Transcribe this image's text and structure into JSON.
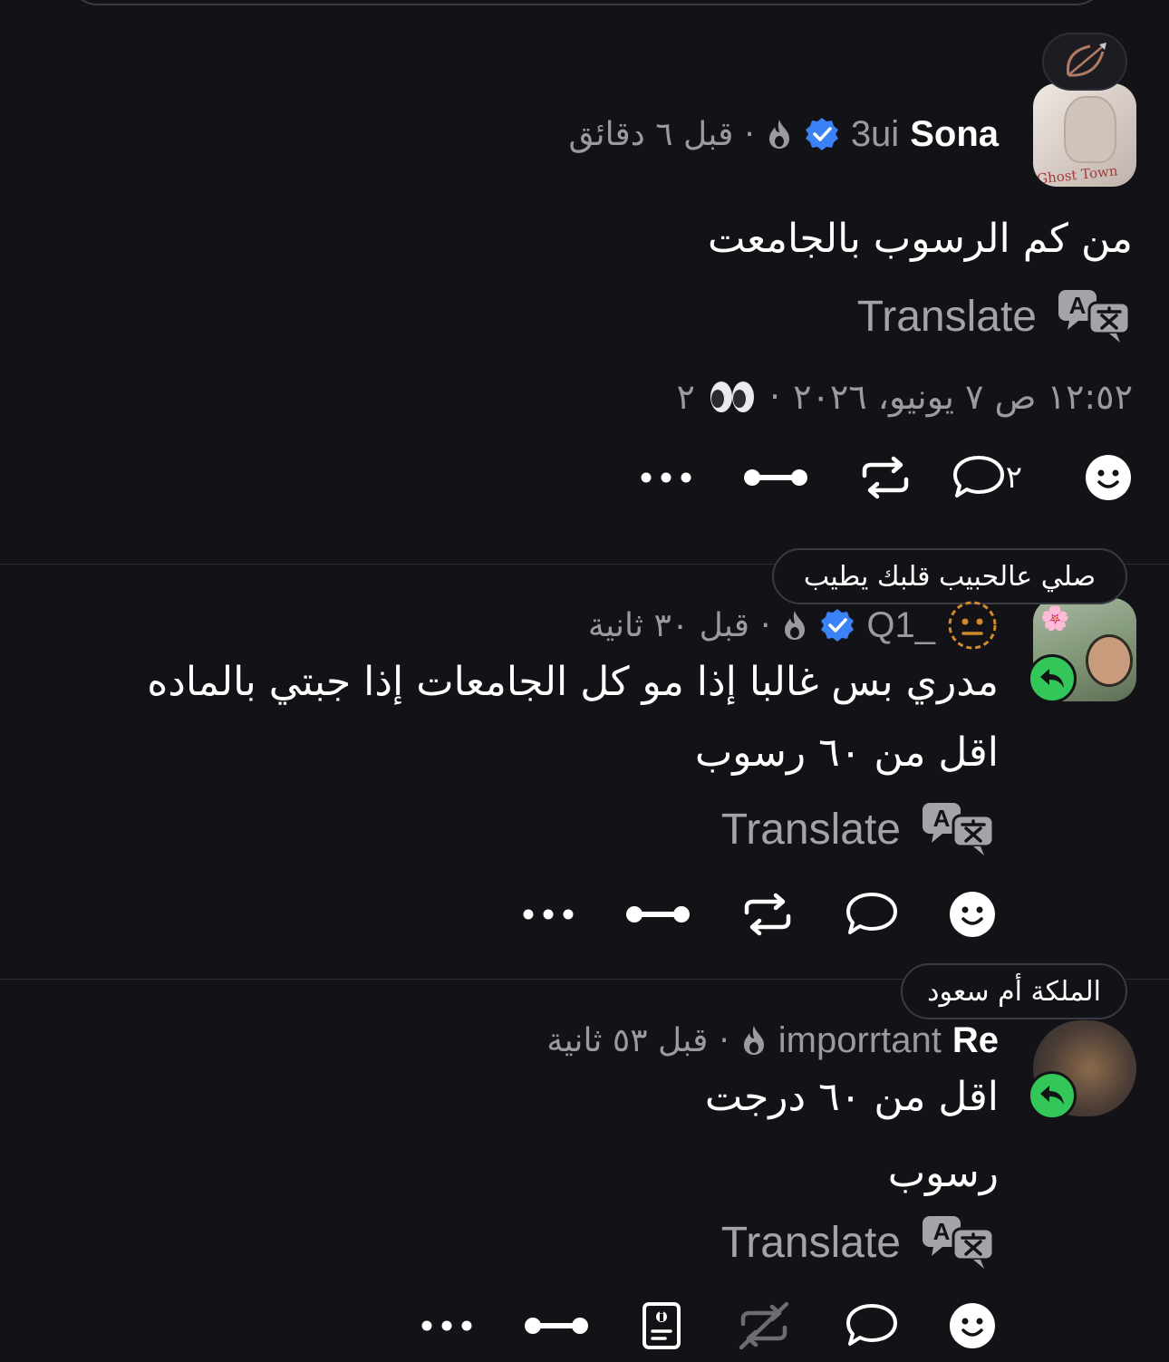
{
  "colors": {
    "background": "#121217",
    "verified": "#3b82f6",
    "reply_badge": "#33c659",
    "muted": "#9a9aa2"
  },
  "post": {
    "name": "Sona",
    "handle": "3ui",
    "time_ago": "قبل ٦ دقائق",
    "dot": "·",
    "text": "من كم الرسوب بالجامعت",
    "translate_label": "Translate",
    "timestamp": "١٢:٥٢ ص ٧ يونيو، ٢٠٢٦",
    "views": "٢",
    "reply_count": "٢",
    "avatar_text": "Ghost Town"
  },
  "replies": [
    {
      "tooltip": "صلي عالحبيب قلبك يطيب",
      "handle": "Q1_",
      "time_ago": "قبل ٣٠ ثانية",
      "dot": "·",
      "text_lines": [
        "مدري بس غالبا إذا مو كل الجامعات إذا جبتي بالماده",
        "اقل من ٦٠ رسوب"
      ],
      "translate_label": "Translate"
    },
    {
      "tooltip": "الملكة أم سعود",
      "name": "Re",
      "handle": "imporrtant",
      "time_ago": "قبل ٥٣ ثانية",
      "dot": "·",
      "text_lines": [
        "اقل من ٦٠ درجت",
        "رسوب"
      ],
      "translate_label": "Translate"
    }
  ]
}
